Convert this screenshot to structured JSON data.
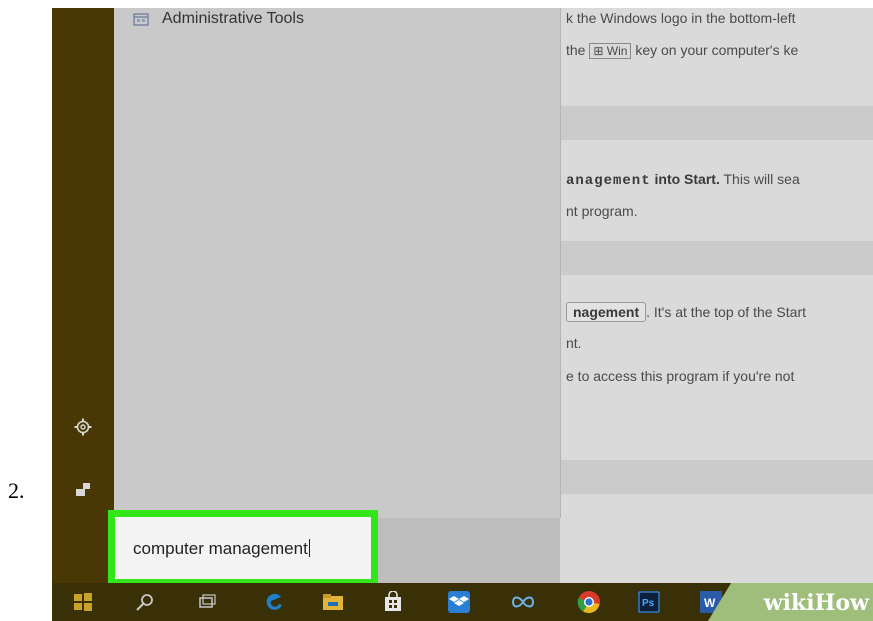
{
  "step_number": "2.",
  "start_menu": {
    "list_item": "Administrative Tools",
    "search_value": "computer management"
  },
  "article": {
    "line1": "k the Windows logo in the bottom-left",
    "line2_prefix": "the",
    "line2_key": "⊞ Win",
    "line2_suffix": "key on your computer's ke",
    "line3_code": "anagement",
    "line3_bold": "into Start.",
    "line3_rest": "This will sea",
    "line4": "nt program.",
    "line5_button": "nagement",
    "line5_rest": ". It's at the top of the Start",
    "line6": "nt.",
    "line7": "e to access this program if you're not"
  },
  "watermark": {
    "text": "wikiHow"
  },
  "colors": {
    "highlight_border": "#33e61a",
    "taskbar": "#3a3007",
    "start_strip": "#4a3706"
  },
  "icons": [
    "settings-icon",
    "power-icon",
    "windows-logo-icon",
    "search-icon",
    "task-view-icon",
    "edge-icon",
    "file-explorer-icon",
    "store-icon",
    "dropbox-icon",
    "infinity-app-icon",
    "chrome-icon",
    "photoshop-icon",
    "word-icon"
  ]
}
